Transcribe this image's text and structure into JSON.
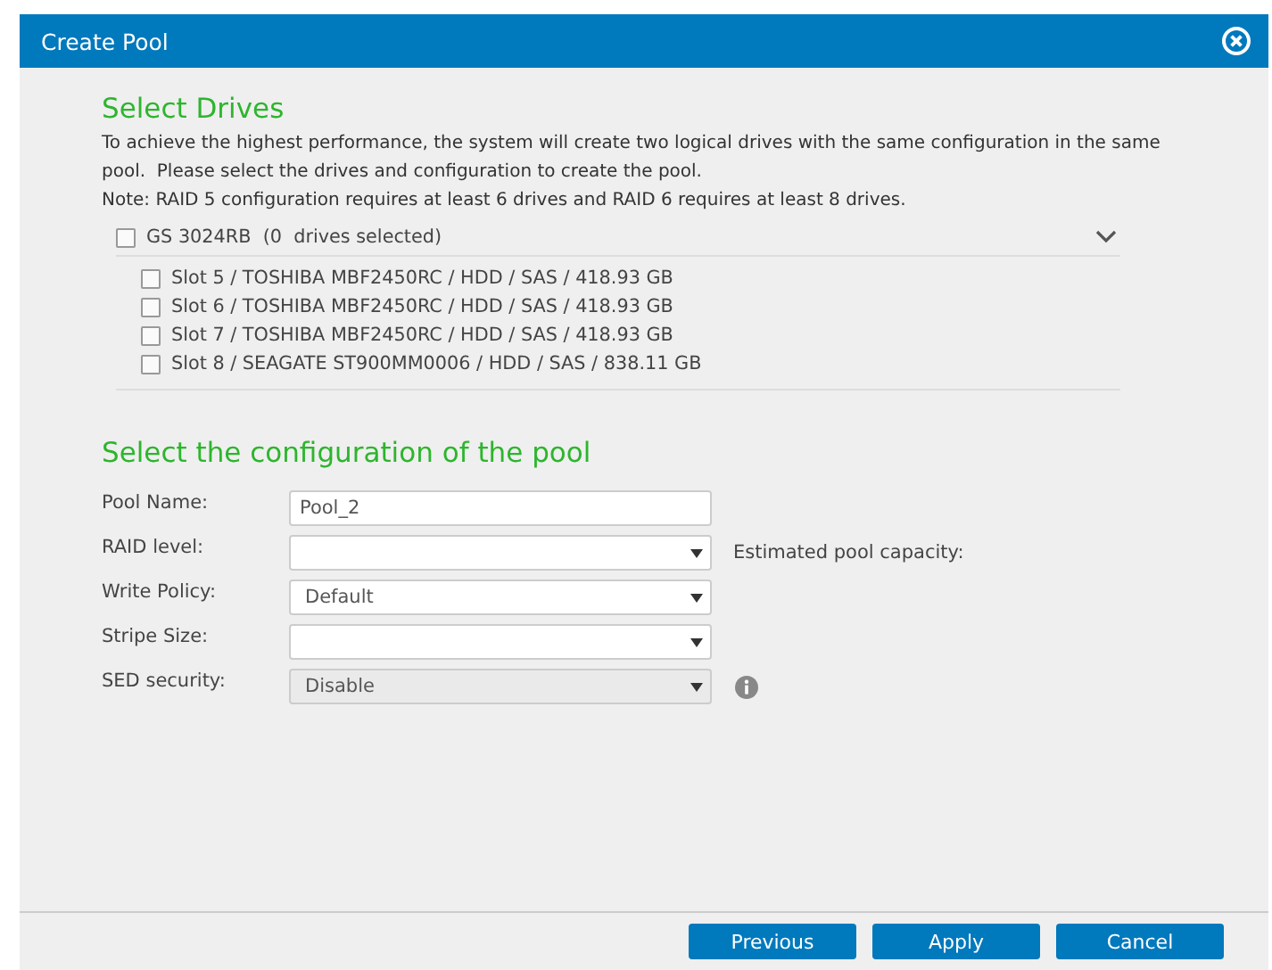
{
  "window": {
    "title": "Create Pool"
  },
  "drives_section": {
    "heading": "Select Drives",
    "description": [
      "To achieve the highest performance, the system will create two logical drives with the same configuration in the same pool.  Please select the drives and configuration to create the pool.",
      "Note: RAID 5 configuration requires at least 6 drives and RAID 6 requires at least 8 drives."
    ],
    "enclosure": {
      "label": "GS 3024RB  (0  drives selected)",
      "checked": false,
      "expanded": true,
      "children": [
        {
          "label": "Slot 5 / TOSHIBA MBF2450RC / HDD / SAS / 418.93 GB",
          "checked": false
        },
        {
          "label": "Slot 6 / TOSHIBA MBF2450RC / HDD / SAS / 418.93 GB",
          "checked": false
        },
        {
          "label": "Slot 7 / TOSHIBA MBF2450RC / HDD / SAS / 418.93 GB",
          "checked": false
        },
        {
          "label": "Slot 8 / SEAGATE ST900MM0006 / HDD / SAS / 838.11 GB",
          "checked": false
        }
      ]
    }
  },
  "config_section": {
    "heading": "Select the configuration of the pool",
    "fields": [
      {
        "label": "Pool Name:",
        "kind": "text",
        "value": "Pool_2",
        "disabled": false
      },
      {
        "label": "RAID level:",
        "kind": "select",
        "disabled": false,
        "note": "Estimated pool capacity:"
      },
      {
        "label": "Write Policy:",
        "kind": "select",
        "value": "Default",
        "disabled": false
      },
      {
        "label": "Stripe Size:",
        "kind": "select",
        "disabled": false
      },
      {
        "label": "SED security:",
        "kind": "select",
        "value": "Disable",
        "disabled": true,
        "info": true
      }
    ]
  },
  "buttons": [
    "Previous",
    "Apply",
    "Cancel"
  ]
}
